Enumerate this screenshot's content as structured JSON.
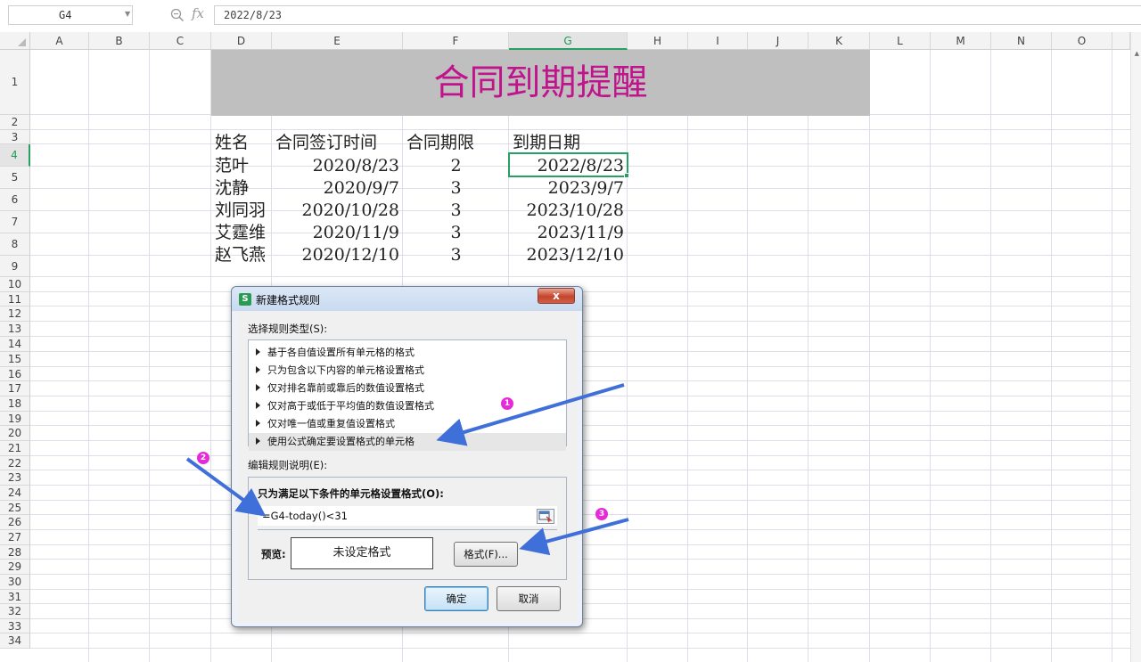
{
  "formula_bar": {
    "cell_ref": "G4",
    "fx_label": "fx",
    "formula": "2022/8/23"
  },
  "columns": [
    "A",
    "B",
    "C",
    "D",
    "E",
    "F",
    "G",
    "H",
    "I",
    "J",
    "K",
    "L",
    "M",
    "N",
    "O"
  ],
  "active_column": "G",
  "rows": [
    "1",
    "2",
    "3",
    "4",
    "5",
    "6",
    "7",
    "8",
    "9",
    "10",
    "11",
    "12",
    "13",
    "14",
    "15",
    "16",
    "17",
    "18",
    "19",
    "20",
    "21",
    "22",
    "23",
    "24",
    "25",
    "26",
    "27",
    "28",
    "29",
    "30",
    "31",
    "32",
    "33",
    "34"
  ],
  "active_row": "4",
  "sheet": {
    "title": "合同到期提醒",
    "headers": [
      "姓名",
      "合同签订时间",
      "合同期限",
      "到期日期"
    ],
    "records": [
      [
        "范叶",
        "2020/8/23",
        "2",
        "2022/8/23"
      ],
      [
        "沈静",
        "2020/9/7",
        "3",
        "2023/9/7"
      ],
      [
        "刘同羽",
        "2020/10/28",
        "3",
        "2023/10/28"
      ],
      [
        "艾霆维",
        "2020/11/9",
        "3",
        "2023/11/9"
      ],
      [
        "赵飞燕",
        "2020/12/10",
        "3",
        "2023/12/10"
      ]
    ]
  },
  "dialog": {
    "app_icon": "S",
    "title": "新建格式规则",
    "close_label": "x",
    "rule_type_label": "选择规则类型(S):",
    "rule_types": [
      "基于各自值设置所有单元格的格式",
      "只为包含以下内容的单元格设置格式",
      "仅对排名靠前或靠后的数值设置格式",
      "仅对高于或低于平均值的数值设置格式",
      "仅对唯一值或重复值设置格式",
      "使用公式确定要设置格式的单元格"
    ],
    "selected_rule_index": 5,
    "edit_desc_label": "编辑规则说明(E):",
    "condition_label": "只为满足以下条件的单元格设置格式(O):",
    "formula": "=G4-today()<31",
    "preview_label": "预览:",
    "preview_text": "未设定格式",
    "format_button": "格式(F)...",
    "ok_button": "确定",
    "cancel_button": "取消"
  },
  "annotations": {
    "badges": [
      "1",
      "2",
      "3"
    ],
    "color": "#e62ad8",
    "arrow_color": "#3f6fd8"
  },
  "colors": {
    "title_text": "#c0148c",
    "title_band": "#bfbfbf",
    "selection": "#27a064"
  }
}
